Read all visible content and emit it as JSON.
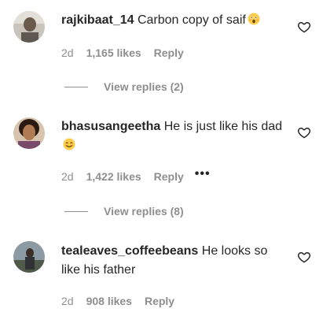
{
  "comments": [
    {
      "username": "rajkibaat_14",
      "text": "Carbon copy of saif",
      "emoji": "astonished-face",
      "time": "2d",
      "likes": "1,165 likes",
      "reply_label": "Reply",
      "view_replies": "View replies (2)"
    },
    {
      "username": "bhasusangeetha",
      "text": "He is just like his dad",
      "emoji": "smiling-face",
      "time": "2d",
      "likes": "1,422 likes",
      "reply_label": "Reply",
      "more_label": "•••",
      "view_replies": "View replies (8)"
    },
    {
      "username": "tealeaves_coffeebeans",
      "text": "He looks so like his father",
      "time": "2d",
      "likes": "908 likes",
      "reply_label": "Reply"
    }
  ],
  "colors": {
    "text": "#262626",
    "muted": "#8e8e8e",
    "background": "#ffffff"
  }
}
